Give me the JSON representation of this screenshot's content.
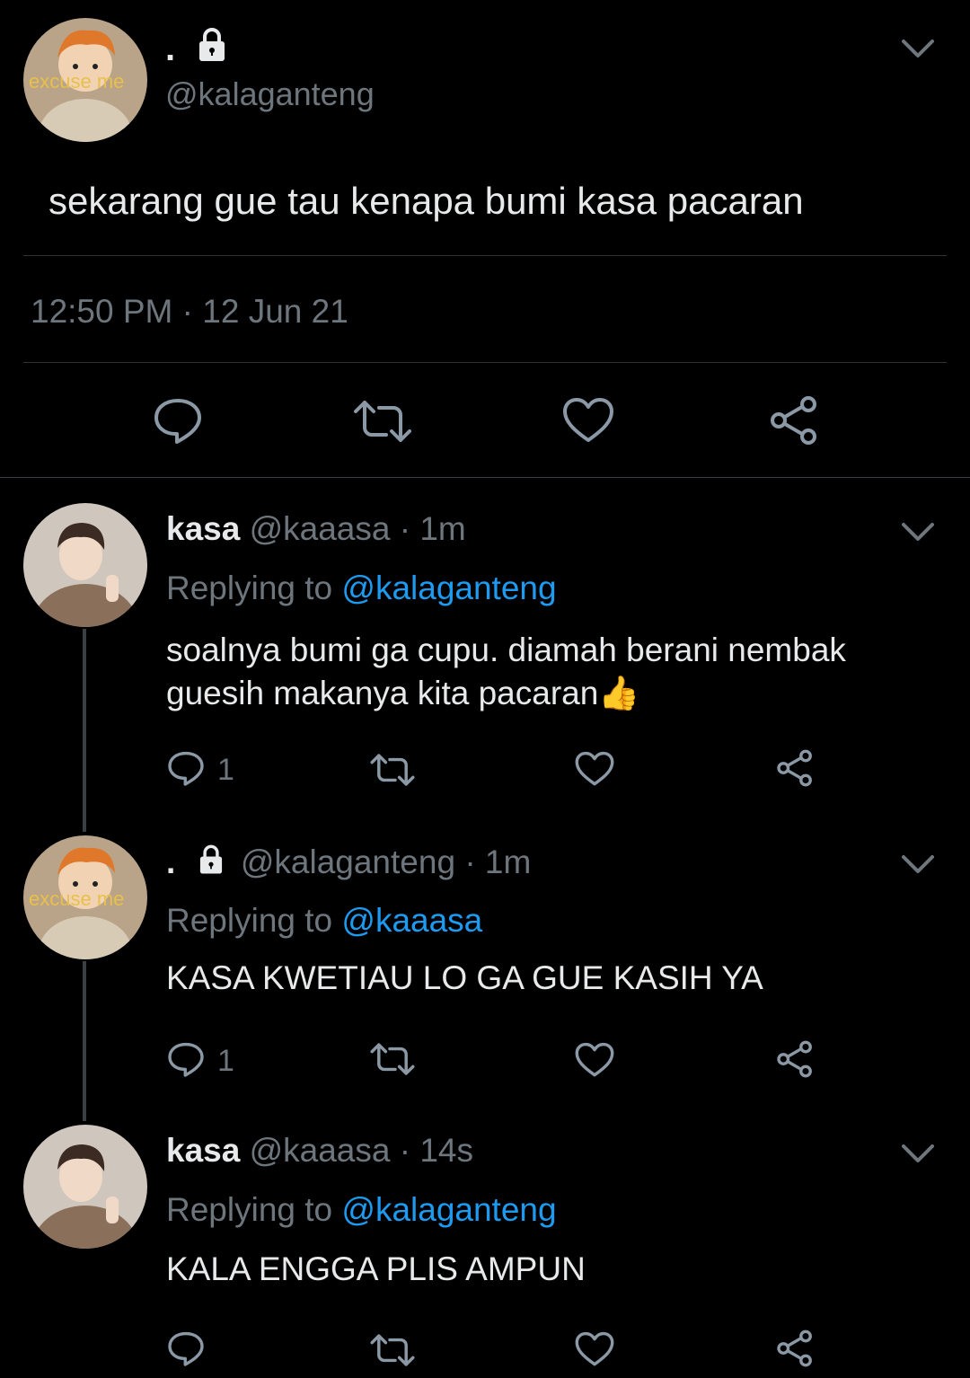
{
  "main_tweet": {
    "display_name": ".",
    "handle": "@kalaganteng",
    "avatar_caption": "excuse me",
    "text": "sekarang gue tau kenapa bumi kasa pacaran",
    "time": "12:50 PM",
    "separator": "·",
    "date": "12 Jun 21"
  },
  "replies": [
    {
      "display_name": "kasa",
      "handle": "@kaaasa",
      "separator": "·",
      "time": "1m",
      "replying_prefix": "Replying to",
      "replying_handle": "@kalaganteng",
      "text_line1": "soalnya bumi ga cupu. diamah berani nembak",
      "text_line2": "guesih makanya kita pacaran",
      "emoji": "👍",
      "reply_count": "1"
    },
    {
      "display_name": ".",
      "handle": "@kalaganteng",
      "avatar_caption": "excuse me",
      "separator": "·",
      "time": "1m",
      "replying_prefix": "Replying to",
      "replying_handle": "@kaaasa",
      "text": "KASA KWETIAU LO GA GUE KASIH YA",
      "reply_count": "1"
    },
    {
      "display_name": "kasa",
      "handle": "@kaaasa",
      "separator": "·",
      "time": "14s",
      "replying_prefix": "Replying to",
      "replying_handle": "@kalaganteng",
      "text": "KALA ENGGA PLIS AMPUN"
    }
  ],
  "colors": {
    "background": "#000000",
    "muted": "#6e767d",
    "link": "#1d9bf0",
    "text": "#e7e9ea"
  }
}
